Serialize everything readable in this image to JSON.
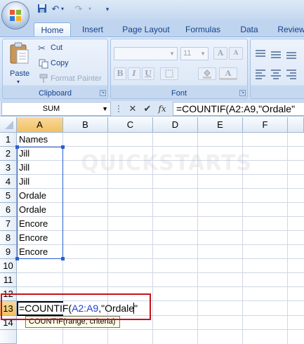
{
  "qat": {
    "office_button": "office-button",
    "save": "save-icon",
    "undo": "undo-icon",
    "redo": "redo-icon"
  },
  "ribbon": {
    "tabs": [
      {
        "label": "Home",
        "active": true
      },
      {
        "label": "Insert"
      },
      {
        "label": "Page Layout"
      },
      {
        "label": "Formulas"
      },
      {
        "label": "Data"
      },
      {
        "label": "Review"
      }
    ],
    "clipboard": {
      "paste_label": "Paste",
      "cut_label": "Cut",
      "copy_label": "Copy",
      "format_painter_label": "Format Painter",
      "group_label": "Clipboard"
    },
    "font": {
      "font_name": "",
      "font_size": "11",
      "bold": "B",
      "italic": "I",
      "underline": "U",
      "grow": "A",
      "shrink": "A",
      "font_color": "A",
      "group_label": "Font"
    }
  },
  "formula_bar": {
    "name_box": "SUM",
    "cancel_icon": "x-icon",
    "enter_icon": "check-icon",
    "fx_label": "fx",
    "formula": "=COUNTIF(A2:A9,\"Ordale\""
  },
  "sheet": {
    "columns": [
      "A",
      "B",
      "C",
      "D",
      "E",
      "F"
    ],
    "rows": [
      "1",
      "2",
      "3",
      "4",
      "5",
      "6",
      "7",
      "8",
      "9",
      "10",
      "11",
      "12",
      "13",
      "14"
    ],
    "cells": [
      {
        "row": "1",
        "value": "Names"
      },
      {
        "row": "2",
        "value": "Jill"
      },
      {
        "row": "3",
        "value": "Jill"
      },
      {
        "row": "4",
        "value": "Jill"
      },
      {
        "row": "5",
        "value": "Ordale"
      },
      {
        "row": "6",
        "value": "Ordale"
      },
      {
        "row": "7",
        "value": "Encore"
      },
      {
        "row": "8",
        "value": "Encore"
      },
      {
        "row": "9",
        "value": "Encore"
      }
    ],
    "edit_cell": {
      "prefix": "=COUNTIF(",
      "ref": "A2:A9",
      "suffix": ",\"Ordale\""
    },
    "tooltip": "COUNTIF(range, criteria)",
    "watermark": "QUICKSTARTS"
  },
  "colors": {
    "range_border": "#2b5fd9",
    "highlight_border": "#c4131c",
    "header_selected": "#f1c15f"
  }
}
